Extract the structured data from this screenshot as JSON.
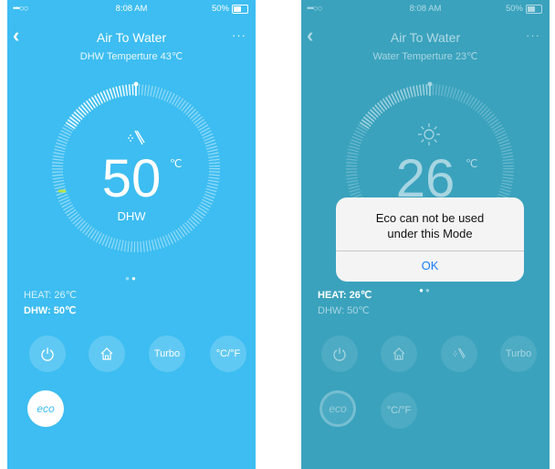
{
  "left": {
    "status": {
      "signal": "•••○○",
      "time": "8:08 AM",
      "battery": "50%"
    },
    "title": "Air To Water",
    "subtitle": "DHW Temperture 43℃",
    "temperature": "50",
    "unit": "℃",
    "mode": "DHW",
    "heat_line": "HEAT: 26℃",
    "dhw_line": "DHW: 50℃",
    "buttons": {
      "turbo": "Turbo",
      "cf": "°C/°F",
      "eco": "eco"
    }
  },
  "right": {
    "status": {
      "signal": "•••○○",
      "time": "8:08 AM",
      "battery": "50%"
    },
    "title": "Air To Water",
    "subtitle": "Water Temperture 23℃",
    "temperature": "26",
    "unit": "℃",
    "heat_line": "HEAT: 26℃",
    "dhw_line": "DHW: 50℃",
    "buttons": {
      "turbo": "Turbo",
      "cf": "°C/°F",
      "eco": "eco"
    },
    "dialog": {
      "message_line1": "Eco can not be used",
      "message_line2": "under this Mode",
      "ok": "OK"
    }
  },
  "colors": {
    "left_bg": "#3dbdf1",
    "right_bg": "#3aa2bd",
    "dialog_ok": "#1a7cf5"
  },
  "icons": [
    "chevron-left-icon",
    "more-icon",
    "shower-icon",
    "sun-icon",
    "power-icon",
    "home-icon"
  ]
}
